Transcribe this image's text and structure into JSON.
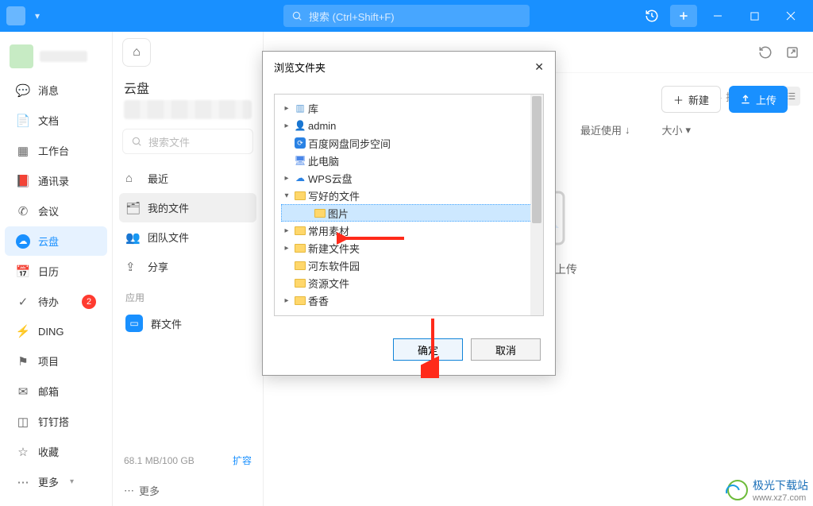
{
  "titlebar": {
    "search_placeholder": "搜索 (Ctrl+Shift+F)"
  },
  "nav": {
    "items": [
      {
        "label": "消息",
        "icon": "chat"
      },
      {
        "label": "文档",
        "icon": "doc"
      },
      {
        "label": "工作台",
        "icon": "grid"
      },
      {
        "label": "通讯录",
        "icon": "book"
      },
      {
        "label": "会议",
        "icon": "phone"
      },
      {
        "label": "云盘",
        "icon": "cloud",
        "active": true
      },
      {
        "label": "日历",
        "icon": "cal"
      },
      {
        "label": "待办",
        "icon": "check",
        "badge": "2"
      },
      {
        "label": "DING",
        "icon": "bolt"
      },
      {
        "label": "项目",
        "icon": "flag"
      },
      {
        "label": "邮箱",
        "icon": "mail"
      },
      {
        "label": "钉钉搭",
        "icon": "block"
      },
      {
        "label": "收藏",
        "icon": "star"
      }
    ],
    "more": "更多"
  },
  "side": {
    "title": "云盘",
    "search_placeholder": "搜索文件",
    "items": [
      {
        "label": "最近",
        "icon": "home"
      },
      {
        "label": "我的文件",
        "icon": "folder",
        "active": true
      },
      {
        "label": "团队文件",
        "icon": "team"
      },
      {
        "label": "分享",
        "icon": "share"
      }
    ],
    "section": "应用",
    "group_files": "群文件",
    "storage": "68.1 MB/100 GB",
    "expand": "扩容",
    "more": "更多"
  },
  "content": {
    "new_btn": "新建",
    "upload_btn": "上传",
    "sort_label": "排序",
    "filter_recent": "最近使用",
    "filter_size": "大小",
    "drop_text": "此处，极速上传"
  },
  "dialog": {
    "title": "浏览文件夹",
    "tree": [
      {
        "label": "库",
        "depth": 0,
        "icon": "lib",
        "exp": ">"
      },
      {
        "label": "admin",
        "depth": 0,
        "icon": "user",
        "exp": ">"
      },
      {
        "label": "百度网盘同步空间",
        "depth": 0,
        "icon": "baidu",
        "exp": ""
      },
      {
        "label": "此电脑",
        "depth": 0,
        "icon": "pc",
        "exp": ""
      },
      {
        "label": "WPS云盘",
        "depth": 0,
        "icon": "wps",
        "exp": ">"
      },
      {
        "label": "写好的文件",
        "depth": 0,
        "icon": "fold",
        "exp": "v"
      },
      {
        "label": "图片",
        "depth": 1,
        "icon": "fold",
        "exp": "",
        "selected": true
      },
      {
        "label": "常用素材",
        "depth": 0,
        "icon": "fold",
        "exp": ">"
      },
      {
        "label": "新建文件夹",
        "depth": 0,
        "icon": "fold",
        "exp": ">"
      },
      {
        "label": "河东软件园",
        "depth": 0,
        "icon": "fold",
        "exp": ""
      },
      {
        "label": "资源文件",
        "depth": 0,
        "icon": "fold",
        "exp": ""
      },
      {
        "label": "香香",
        "depth": 0,
        "icon": "fold",
        "exp": ">"
      }
    ],
    "ok": "确定",
    "cancel": "取消"
  },
  "watermark": {
    "text": "极光下载站",
    "url": "www.xz7.com"
  }
}
